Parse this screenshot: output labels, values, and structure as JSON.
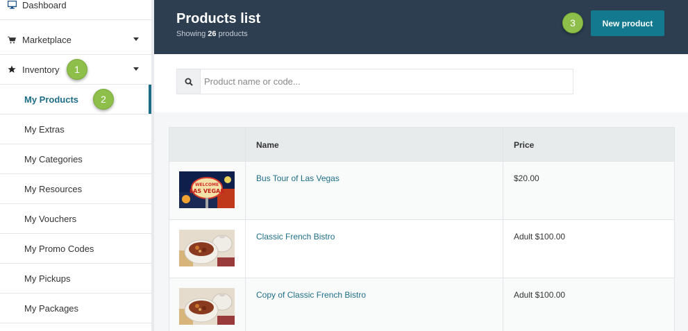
{
  "sidebar": {
    "items": [
      {
        "label": "Dashboard",
        "icon": "monitor-icon"
      },
      {
        "label": "Marketplace",
        "icon": "cart-icon"
      },
      {
        "label": "Inventory",
        "icon": "star-icon"
      }
    ],
    "sub_items": [
      {
        "label": "My Products",
        "active": true
      },
      {
        "label": "My Extras"
      },
      {
        "label": "My Categories"
      },
      {
        "label": "My Resources"
      },
      {
        "label": "My Vouchers"
      },
      {
        "label": "My Promo Codes"
      },
      {
        "label": "My Pickups"
      },
      {
        "label": "My Packages"
      }
    ]
  },
  "badges": [
    "1",
    "2",
    "3"
  ],
  "header": {
    "title": "Products list",
    "subtitle_prefix": "Showing",
    "count": "26",
    "subtitle_suffix": "products",
    "new_button": "New product"
  },
  "search": {
    "placeholder": "Product name or code..."
  },
  "table": {
    "columns": [
      "",
      "Name",
      "Price"
    ],
    "rows": [
      {
        "name": "Bus Tour of Las Vegas",
        "price": "$20.00",
        "image": "las-vegas-sign"
      },
      {
        "name": "Classic French Bistro",
        "price": "Adult $100.00",
        "image": "soup-bowl"
      },
      {
        "name": "Copy of Classic French Bistro",
        "price": "Adult $100.00",
        "image": "soup-bowl"
      }
    ]
  },
  "colors": {
    "header_bg": "#2c3e50",
    "accent": "#1d6d86",
    "button": "#12798f",
    "badge": "#8dbf4a"
  }
}
